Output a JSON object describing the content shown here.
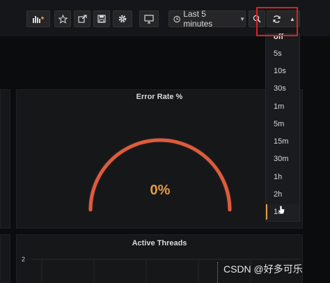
{
  "toolbar": {
    "icons": [
      "add-panel-icon",
      "star-icon",
      "share-icon",
      "save-icon",
      "gear-icon",
      "tv-icon"
    ],
    "time_range_label": "Last 5 minutes",
    "clock_icon": "clock-icon",
    "search_icon": "search-icon",
    "refresh_icon": "refresh-icon"
  },
  "refresh_dropdown": {
    "partial_top": "off",
    "items": [
      "5s",
      "10s",
      "30s",
      "1m",
      "5m",
      "15m",
      "30m",
      "1h",
      "2h",
      "1d"
    ],
    "hovered_item": "1d"
  },
  "panels": {
    "error_rate": {
      "title": "Error Rate %",
      "value": "0%",
      "gauge_fraction": 0
    },
    "active_threads": {
      "title": "Active Threads",
      "y_tick": "2"
    }
  },
  "watermark": "CSDN @好多可乐",
  "colors": {
    "accent": "#e59a46",
    "gauge_arc": "#e05b3b",
    "highlight": "#e02020",
    "background": "#0b0c0e",
    "panel_bg": "#161719"
  }
}
